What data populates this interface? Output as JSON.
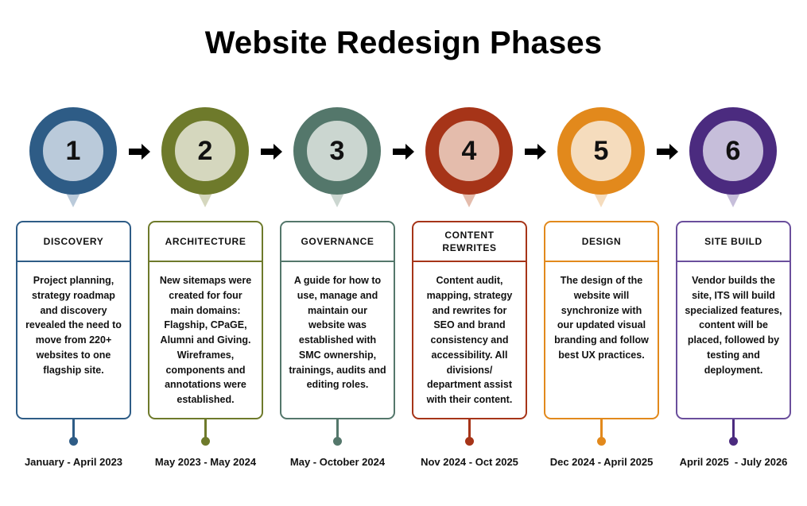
{
  "page": {
    "title": "Website Redesign Phases",
    "background": "#ffffff"
  },
  "arrow_icon_name": "arrow-right-icon",
  "phases": [
    {
      "number": "1",
      "header": "DISCOVERY",
      "body": "Project planning, strategy roadmap and discovery revealed the need to move from 220+ websites to one flagship site.",
      "date": "January - April 2023",
      "ring_color": "#2E5C86",
      "fill_color": "#BACADA",
      "border_color": "#2E5C86",
      "dot_color": "#2E5C86"
    },
    {
      "number": "2",
      "header": "ARCHITECTURE",
      "body": "New sitemaps were created for four main domains: Flagship, CPaGE, Alumni and Giving. Wireframes, components and annotations were established.",
      "date": "May 2023 - May 2024",
      "ring_color": "#6E7A2B",
      "fill_color": "#D5D7BE",
      "border_color": "#6E7A2B",
      "dot_color": "#6E7A2B"
    },
    {
      "number": "3",
      "header": "GOVERNANCE",
      "body": "A guide for how to use, manage and maintain our website was established with SMC ownership, trainings, audits and editing roles.",
      "date": "May - October 2024",
      "ring_color": "#54776B",
      "fill_color": "#CBD6D0",
      "border_color": "#54776B",
      "dot_color": "#54776B"
    },
    {
      "number": "4",
      "header": "CONTENT REWRITES",
      "body": "Content audit, mapping, strategy and rewrites for SEO and brand consistency and accessibility. All divisions/ department assist with their content.",
      "date": "Nov 2024 - Oct 2025",
      "ring_color": "#A63418",
      "fill_color": "#E4BCAC",
      "border_color": "#A63418",
      "dot_color": "#A63418"
    },
    {
      "number": "5",
      "header": "DESIGN",
      "body": "The design of the website will synchronize with our updated visual branding and follow best UX practices.",
      "date": "Dec 2024 - April 2025",
      "ring_color": "#E2891C",
      "fill_color": "#F5DCBD",
      "border_color": "#E2891C",
      "dot_color": "#E2891C"
    },
    {
      "number": "6",
      "header": "SITE BUILD",
      "body": "Vendor builds the site, ITS will build specialized features, content will be placed, followed by testing and deployment.",
      "date": "April 2025  - July 2026",
      "ring_color": "#4B2B7F",
      "fill_color": "#C6BEDA",
      "border_color": "#6A4E9C",
      "dot_color": "#4B2B7F"
    }
  ]
}
